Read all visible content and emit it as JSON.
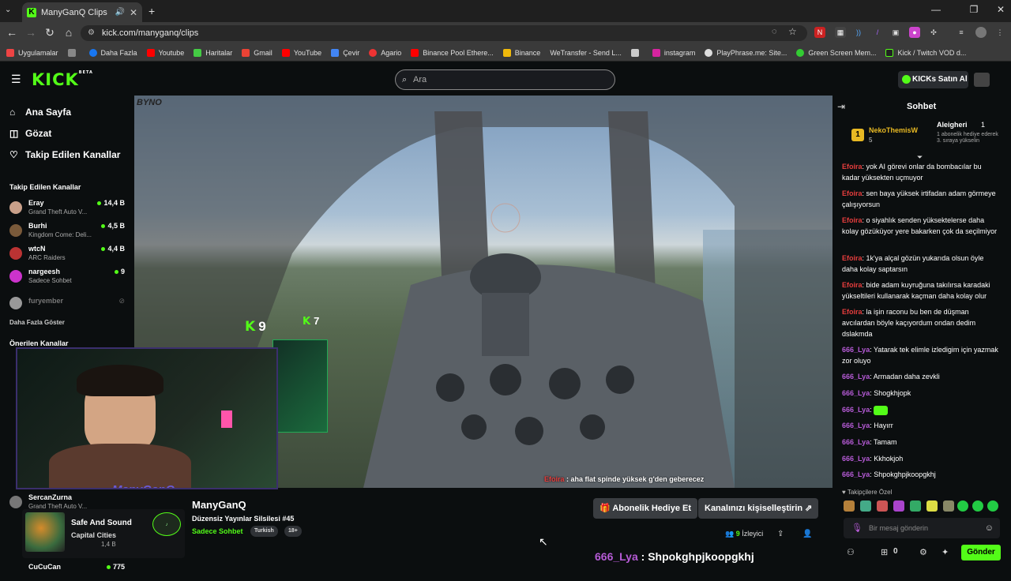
{
  "browser": {
    "tab_title": "ManyGanQ Clips - Watch L",
    "url": "kick.com/manyganq/clips",
    "bookmarks": [
      "Uygulamalar",
      "Daha Fazla",
      "Youtube",
      "Haritalar",
      "Gmail",
      "YouTube",
      "Çevir",
      "Agario",
      "Binance Pool Ethere...",
      "Binance",
      "WeTransfer - Send L...",
      "instagram",
      "PlayPhrase.me: Site...",
      "Green Screen Mem...",
      "Kick / Twitch VOD d..."
    ]
  },
  "header": {
    "logo": "KICK",
    "logo_sup": "BETA",
    "search_placeholder": "Ara",
    "kicks_button": "KICKs Satın Al"
  },
  "sidebar": {
    "nav": [
      {
        "label": "Ana Sayfa",
        "icon": "home-icon"
      },
      {
        "label": "Gözat",
        "icon": "browse-icon"
      },
      {
        "label": "Takip Edilen Kanallar",
        "icon": "heart-icon"
      }
    ],
    "followed_title": "Takip Edilen Kanallar",
    "followed": [
      {
        "name": "Eray",
        "game": "Grand Theft Auto V...",
        "viewers": "14,4 B"
      },
      {
        "name": "Burhi",
        "game": "Kingdom Come: Deli...",
        "viewers": "4,5 B"
      },
      {
        "name": "wtcN",
        "game": "ARC Raiders",
        "viewers": "4,4 B"
      },
      {
        "name": "nargeesh",
        "game": "Sadece Sohbet",
        "viewers": "9"
      },
      {
        "name": "furyember",
        "game": "",
        "viewers": ""
      }
    ],
    "show_more": "Daha Fazla Göster",
    "recommended_title": "Önerilen Kanallar",
    "recommended": [
      {
        "name": "SercanZurna",
        "game": "Grand Theft Auto V...",
        "viewers": "1,4 B"
      },
      {
        "name": "CuCuCan",
        "game": "",
        "viewers": "775"
      }
    ]
  },
  "video": {
    "top_badge": "BYNO",
    "kick_count_1": "9",
    "kick_count_2": "7",
    "overlay_user": "Efoira",
    "overlay_text": ": aha flat spinde yüksek g'den geberecez",
    "webcam_label": "ManyGanQ"
  },
  "stream": {
    "streamer": "ManyGanQ",
    "title": "Düzensiz Yayınlar Silsilesi #45",
    "category": "Sadece Sohbet",
    "tags": [
      "Turkish",
      "18+"
    ],
    "gift_button": "Abonelik Hediye Et",
    "customize_button": "Kanalınızı kişiselleştirin",
    "viewers": "9",
    "viewers_label": "İzleyici",
    "big_msg_user": "666_Lya",
    "big_msg_text": ": Shpokghpjkoopgkhj"
  },
  "music": {
    "title": "Safe And Sound",
    "artist": "Capital Cities"
  },
  "chat": {
    "title": "Sohbet",
    "pinned": {
      "rank": "1",
      "user1": "NekoThemisW",
      "user1_count": "5",
      "user2": "Aleigheri",
      "user2_count": "1",
      "user2_note": "1 abonelik hediye ederek 3. sıraya yükselin"
    },
    "messages": [
      {
        "user": "Efoira",
        "text": "yok AI görevi onlar da bombacılar bu kadar yüksekten uçmuyor",
        "cls": "u-ef"
      },
      {
        "user": "Efoira",
        "text": "sen baya yüksek irtifadan adam görmeye çalışıyorsun",
        "cls": "u-ef"
      },
      {
        "user": "Efoira",
        "text": "o siyahlık senden yüksektelerse daha kolay gözüküyor yere bakarken çok da seçilmiyor",
        "cls": "u-ef"
      },
      {
        "user": "Efoira",
        "text": "1k'ya alçal gözün yukarıda olsun öyle daha kolay saptarsın",
        "cls": "u-ef"
      },
      {
        "user": "Efoira",
        "text": "bide adam kuyruğuna takılırsa karadaki yükseltileri kullanarak kaçman daha kolay olur",
        "cls": "u-ef"
      },
      {
        "user": "Efoira",
        "text": "la işin raconu bu ben de düşman avcılardan böyle kaçıyordum ondan dedim dslakmda",
        "cls": "u-ef"
      },
      {
        "user": "666_Lya",
        "text": "Yatarak tek elimle izledigim için yazmak zor oluyo",
        "cls": "u-ly"
      },
      {
        "user": "666_Lya",
        "text": "Armadan daha zevkli",
        "cls": "u-ly"
      },
      {
        "user": "666_Lya",
        "text": "Shogkhjopk",
        "cls": "u-ly"
      },
      {
        "user": "666_Lya",
        "text": "",
        "cls": "u-ly"
      },
      {
        "user": "666_Lya",
        "text": "Hayırr",
        "cls": "u-ly"
      },
      {
        "user": "666_Lya",
        "text": "Tamam",
        "cls": "u-ly"
      },
      {
        "user": "666_Lya",
        "text": "Kkhokjoh",
        "cls": "u-ly"
      },
      {
        "user": "666_Lya",
        "text": "Shpokghpjkoopgkhj",
        "cls": "u-ly"
      }
    ],
    "subs_label": "Takipçilere Özel",
    "input_placeholder": "Bir mesaj gönderin",
    "send": "Gönder",
    "kicks_count": "0"
  },
  "colors": {
    "accent": "#53fc18",
    "efoira": "#e63d3d",
    "lya": "#b65bd6"
  }
}
